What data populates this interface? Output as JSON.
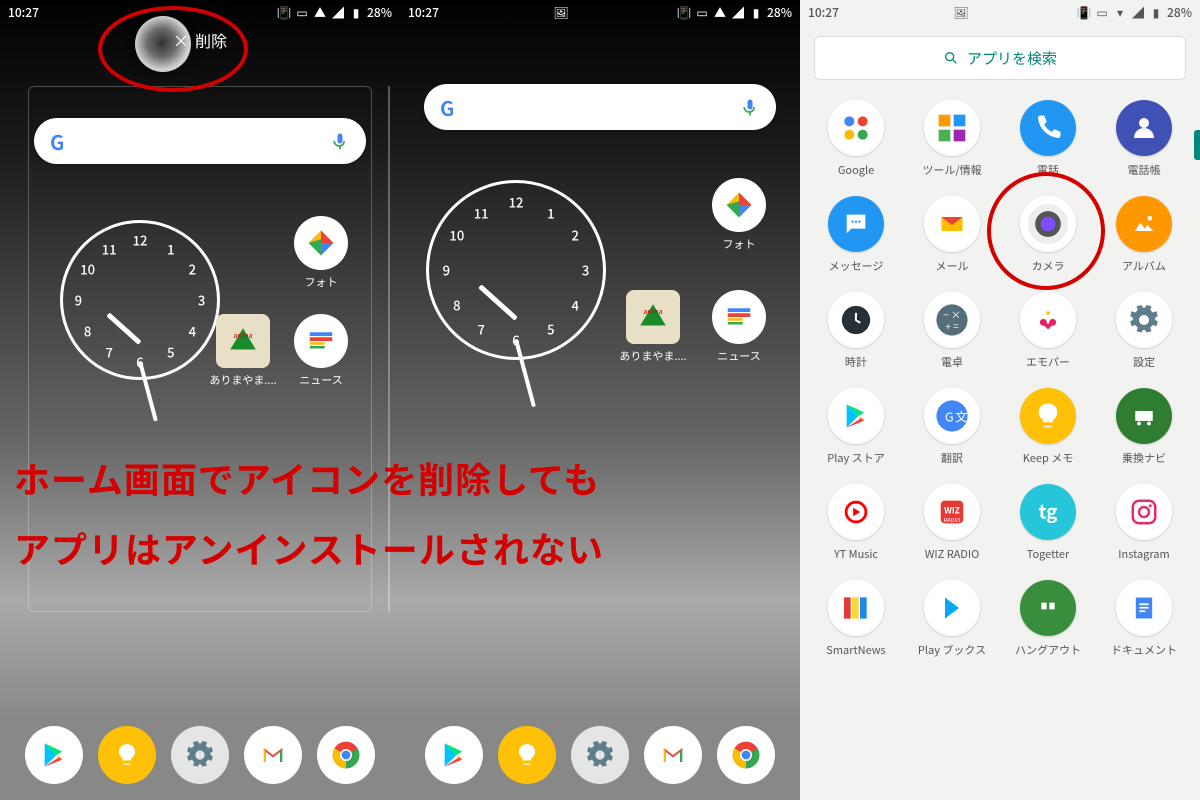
{
  "status": {
    "time": "10:27",
    "battery": "28%"
  },
  "delete_label": "削除",
  "home_apps": {
    "photos": "フォト",
    "arima": "ありまやま....",
    "news": "ニュース"
  },
  "drawer": {
    "search": "アプリを検索",
    "apps": [
      {
        "label": "Google",
        "key": "google"
      },
      {
        "label": "ツール/情報",
        "key": "tools"
      },
      {
        "label": "電話",
        "key": "phone"
      },
      {
        "label": "電話帳",
        "key": "contacts"
      },
      {
        "label": "メッセージ",
        "key": "messages"
      },
      {
        "label": "メール",
        "key": "mail"
      },
      {
        "label": "カメラ",
        "key": "camera"
      },
      {
        "label": "アルバム",
        "key": "album"
      },
      {
        "label": "時計",
        "key": "clock"
      },
      {
        "label": "電卓",
        "key": "calculator"
      },
      {
        "label": "エモパー",
        "key": "emopar"
      },
      {
        "label": "設定",
        "key": "settings"
      },
      {
        "label": "Play ストア",
        "key": "playstore"
      },
      {
        "label": "翻訳",
        "key": "translate"
      },
      {
        "label": "Keep メモ",
        "key": "keep"
      },
      {
        "label": "乗換ナビ",
        "key": "transit"
      },
      {
        "label": "YT Music",
        "key": "ytmusic"
      },
      {
        "label": "WIZ RADIO",
        "key": "wizradio"
      },
      {
        "label": "Togetter",
        "key": "togetter"
      },
      {
        "label": "Instagram",
        "key": "instagram"
      },
      {
        "label": "SmartNews",
        "key": "smartnews"
      },
      {
        "label": "Play ブックス",
        "key": "playbooks"
      },
      {
        "label": "ハングアウト",
        "key": "hangouts"
      },
      {
        "label": "ドキュメント",
        "key": "docs"
      }
    ]
  },
  "annotation": {
    "line1": "ホーム画面でアイコンを削除しても",
    "line2": "アプリはアンインストールされない"
  }
}
